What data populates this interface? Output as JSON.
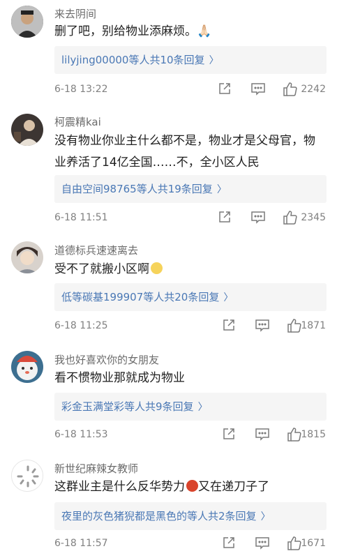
{
  "comments": [
    {
      "username": "来去阴间",
      "text": "删了吧，别给物业添麻烦。🙏🏻",
      "reply_users": "lilyjing00000等人",
      "reply_count": "共10条回复",
      "time": "6-18 13:22",
      "likes": "2242"
    },
    {
      "username": "柯震精kai",
      "text": "没有物业你业主什么都不是，物业才是父母官，物业养活了14亿全国……不，全小区人民",
      "reply_users": "自由空间98765等人",
      "reply_count": "共19条回复",
      "time": "6-18 11:51",
      "likes": "2345"
    },
    {
      "username": "道德标兵速速离去",
      "text": "受不了就搬小区啊",
      "reply_users": "低等碳基199907等人",
      "reply_count": "共20条回复",
      "time": "6-18 11:25",
      "likes": "1871"
    },
    {
      "username": "我也好喜欢你的女朋友",
      "text": "看不惯物业那就成为物业",
      "reply_users": "彩金玉满堂彩等人",
      "reply_count": "共9条回复",
      "time": "6-18 11:53",
      "likes": "1815"
    },
    {
      "username": "新世纪麻辣女教师",
      "text_before": "这群业主是什么反华势力",
      "text_after": "又在递刀子了",
      "reply_users": "夜里的灰色猪猊都是黑色的等人",
      "reply_count": "共2条回复",
      "time": "6-18 11:57",
      "likes": "1671"
    }
  ],
  "colors": {
    "link": "#4a78b5",
    "meta": "#808080",
    "reply_bg": "#f5f5f5"
  },
  "icons": [
    "share-icon",
    "comment-icon",
    "like-icon",
    "chevron-right-icon"
  ]
}
